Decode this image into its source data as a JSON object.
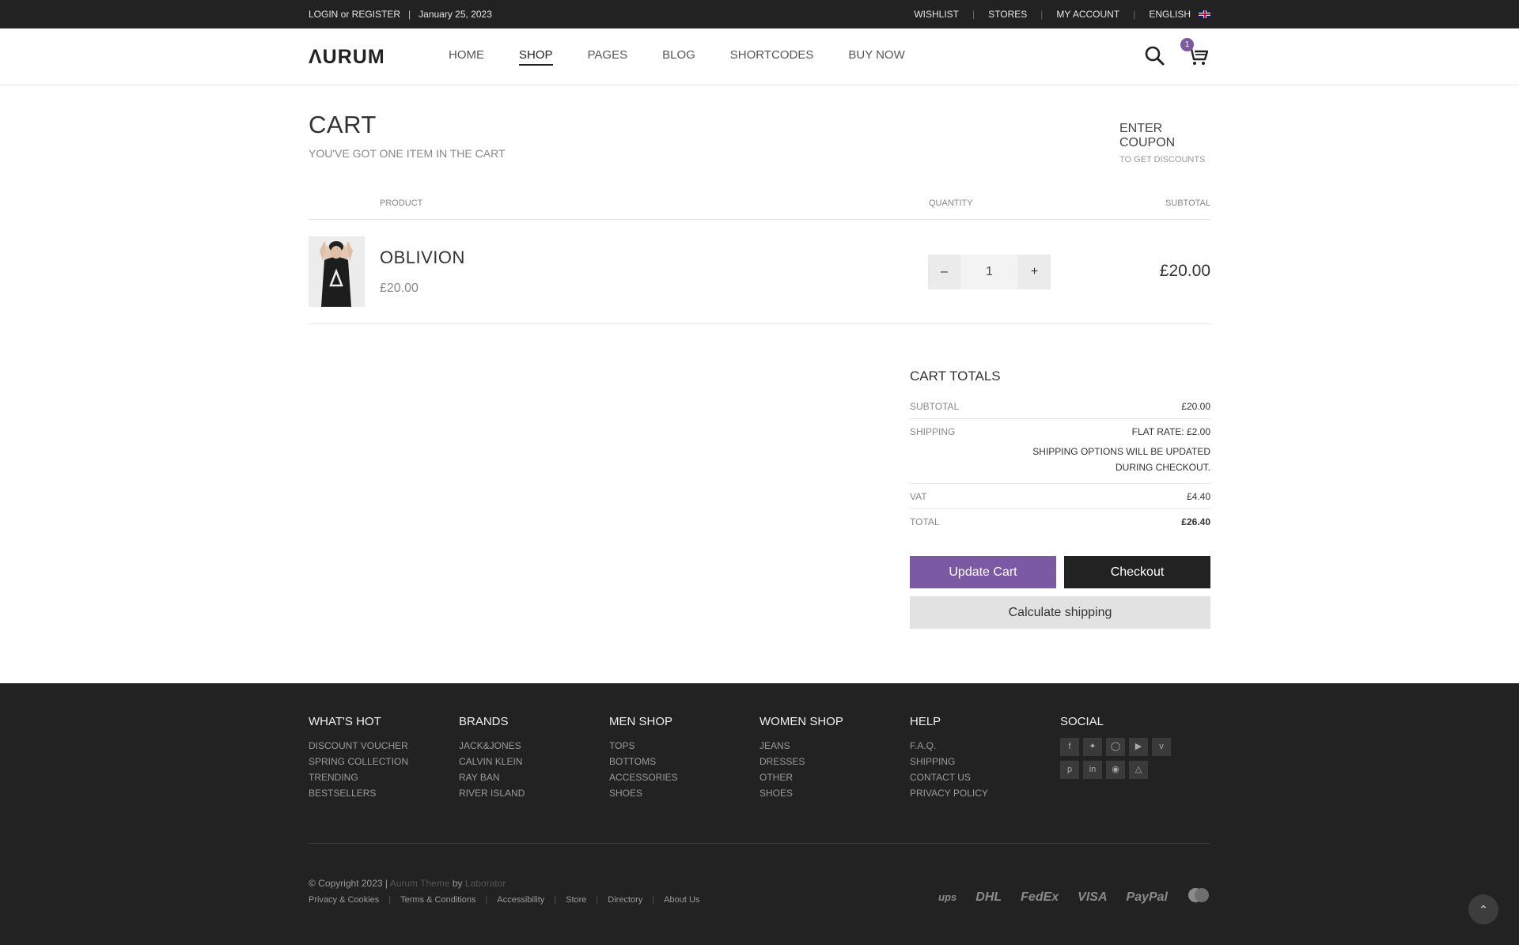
{
  "topbar": {
    "login": "LOGIN or REGISTER",
    "separator": "|",
    "date": "January 25, 2023",
    "links": [
      "WISHLIST",
      "STORES",
      "MY ACCOUNT",
      "ENGLISH"
    ]
  },
  "header": {
    "logo": "ΛURUM",
    "nav": [
      "HOME",
      "SHOP",
      "PAGES",
      "BLOG",
      "SHORTCODES",
      "BUY NOW"
    ],
    "active_nav": "SHOP",
    "cart_count": "1"
  },
  "cart": {
    "title": "CART",
    "subtitle": "YOU'VE GOT ONE ITEM IN THE CART",
    "coupon_title": "ENTER COUPON",
    "coupon_sub": "TO GET DISCOUNTS",
    "columns": {
      "product": "PRODUCT",
      "quantity": "QUANTITY",
      "subtotal": "SUBTOTAL"
    },
    "item": {
      "name": "OBLIVION",
      "price": "£20.00",
      "quantity": "1",
      "minus": "–",
      "plus": "+",
      "subtotal": "£20.00"
    }
  },
  "totals": {
    "title": "CART TOTALS",
    "subtotal_label": "SUBTOTAL",
    "subtotal_value": "£20.00",
    "shipping_label": "SHIPPING",
    "shipping_value": "FLAT RATE: £2.00",
    "shipping_note": "SHIPPING OPTIONS WILL BE UPDATED DURING CHECKOUT.",
    "vat_label": "VAT",
    "vat_value": "£4.40",
    "total_label": "TOTAL",
    "total_value": "£26.40",
    "update_button": "Update Cart",
    "checkout_button": "Checkout",
    "calc_shipping_button": "Calculate shipping"
  },
  "footer": {
    "columns": [
      {
        "title": "WHAT'S HOT",
        "links": [
          "DISCOUNT VOUCHER",
          "SPRING COLLECTION",
          "TRENDING",
          "BESTSELLERS"
        ]
      },
      {
        "title": "BRANDS",
        "links": [
          "JACK&JONES",
          "CALVIN KLEIN",
          "RAY BAN",
          "RIVER ISLAND"
        ]
      },
      {
        "title": "MEN SHOP",
        "links": [
          "TOPS",
          "BOTTOMS",
          "ACCESSORIES",
          "SHOES"
        ]
      },
      {
        "title": "WOMEN SHOP",
        "links": [
          "JEANS",
          "DRESSES",
          "OTHER",
          "SHOES"
        ]
      },
      {
        "title": "HELP",
        "links": [
          "F.A.Q.",
          "SHIPPING",
          "CONTACT US",
          "PRIVACY POLICY"
        ]
      }
    ],
    "social_title": "SOCIAL",
    "social_icons": [
      "facebook-icon",
      "twitter-icon",
      "instagram-icon",
      "youtube-icon",
      "vimeo-icon",
      "pinterest-icon",
      "linkedin-icon",
      "dribbble-icon",
      "snapchat-icon"
    ],
    "copyright": "© Copyright 2023 |",
    "theme_link": "Aurum Theme",
    "by": "by",
    "author_link": "Laborator",
    "bottom_links": [
      "Privacy & Cookies",
      "Terms & Conditions",
      "Accessibility",
      "Store",
      "Directory",
      "About Us"
    ],
    "payments": [
      "ups",
      "DHL",
      "FedEx",
      "VISA",
      "PayPal",
      "mastercard-icon"
    ]
  },
  "colors": {
    "accent": "#7b59a3",
    "dark": "#222222",
    "footer_bg": "#222222"
  }
}
